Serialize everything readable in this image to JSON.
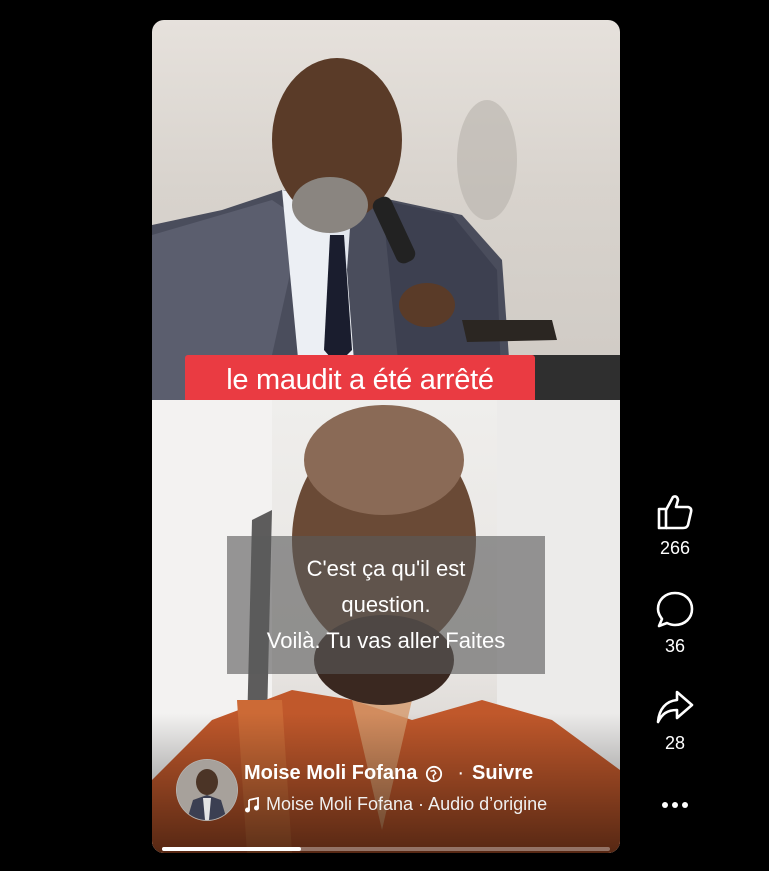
{
  "overlay": {
    "caption": "le maudit a été arrêté"
  },
  "subtitles": [
    "C'est ça qu'il est",
    "question.",
    "Voilà. Tu vas aller Faites"
  ],
  "author": {
    "name": "Moise Moli Fofana",
    "separator": "·",
    "follow_label": "Suivre"
  },
  "audio": {
    "text": "Moise Moli Fofana · Audio d’origine"
  },
  "actions": {
    "likes": "266",
    "comments": "36",
    "shares": "28"
  },
  "playback": {
    "progress": 0.31
  },
  "icons": [
    "like-icon",
    "comment-icon",
    "share-icon",
    "more-icon",
    "globe-icon",
    "music-icon"
  ],
  "colors": {
    "caption_bg": "#ea3b42",
    "background": "#000000"
  }
}
